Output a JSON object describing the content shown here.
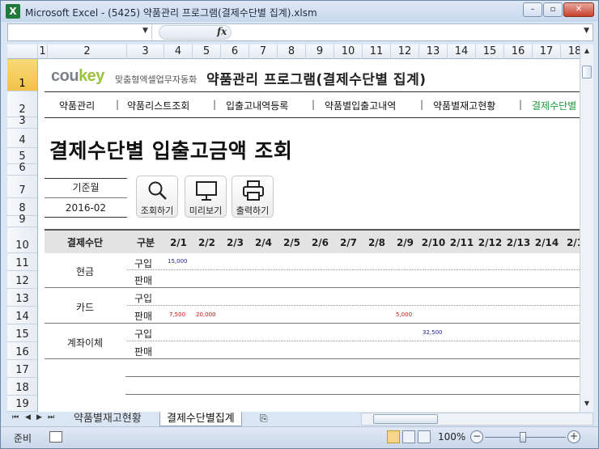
{
  "window": {
    "title": "Microsoft Excel - (5425) 약품관리 프로그램(결제수단별 집계).xlsm",
    "app_icon": "X"
  },
  "formula_bar": {
    "fx": "fx"
  },
  "columns": [
    "1",
    "2",
    "3",
    "4",
    "5",
    "6",
    "7",
    "8",
    "9",
    "10",
    "11",
    "12",
    "13",
    "14",
    "15",
    "16",
    "17",
    "18"
  ],
  "rows": [
    "1",
    "2",
    "3",
    "4",
    "5",
    "6",
    "7",
    "8",
    "9",
    "10",
    "11",
    "12",
    "13",
    "14",
    "15",
    "16",
    "17",
    "18",
    "19"
  ],
  "selected_row": "1",
  "brand": {
    "logo_a": "cou",
    "logo_b": "key",
    "tagline": "맞춤형엑셀업무자동화"
  },
  "program_title": "약품관리 프로그램(결제수단별 집계)",
  "nav": {
    "items": [
      "약품관리",
      "약품리스트조회",
      "입출고내역등록",
      "약품별입출고내역",
      "약품별재고현황",
      "결제수단별"
    ],
    "separator": "|"
  },
  "page_title": "결제수단별 입출고금액 조회",
  "reference": {
    "label": "기준월",
    "value": "2016-02"
  },
  "toolbar": {
    "search_label": "조회하기",
    "preview_label": "미리보기",
    "print_label": "출력하기"
  },
  "table": {
    "headers": {
      "method": "결제수단",
      "type": "구분"
    },
    "days": [
      "2/1",
      "2/2",
      "2/3",
      "2/4",
      "2/5",
      "2/6",
      "2/7",
      "2/8",
      "2/9",
      "2/10",
      "2/11",
      "2/12",
      "2/13",
      "2/14",
      "2/1"
    ],
    "groups": [
      {
        "method": "현금",
        "buy_label": "구입",
        "sell_label": "판매",
        "buy_values": [
          "15,000"
        ],
        "sell_values": []
      },
      {
        "method": "카드",
        "buy_label": "구입",
        "sell_label": "판매",
        "buy_values": [],
        "sell_values": [
          "7,500",
          "20,000",
          "5,000"
        ]
      },
      {
        "method": "계좌이체",
        "buy_label": "구입",
        "sell_label": "판매",
        "buy_values": [
          "32,500"
        ],
        "sell_values": []
      }
    ]
  },
  "sheets": {
    "tab1": "약품별재고현황",
    "tab2": "결제수단별집계"
  },
  "status": {
    "ready": "준비",
    "zoom": "100%"
  }
}
